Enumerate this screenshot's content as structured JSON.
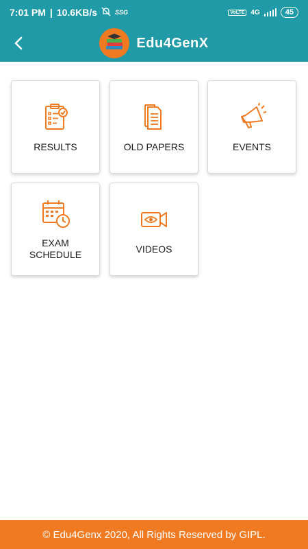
{
  "status_bar": {
    "time": "7:01 PM",
    "net_speed": "10.6KB/s",
    "extra": "SSG",
    "network": "4G",
    "battery": "45"
  },
  "header": {
    "app_name": "Edu4GenX",
    "back_icon": "chevron-left-icon"
  },
  "menu": {
    "results": "RESULTS",
    "old_papers": "OLD PAPERS",
    "events": "EVENTS",
    "exam_schedule": "EXAM SCHEDULE",
    "videos": "VIDEOS"
  },
  "footer": {
    "text": "© Edu4Genx 2020, All Rights Reserved by GIPL."
  },
  "colors": {
    "primary": "#1f9aa6",
    "accent": "#f07a22"
  }
}
